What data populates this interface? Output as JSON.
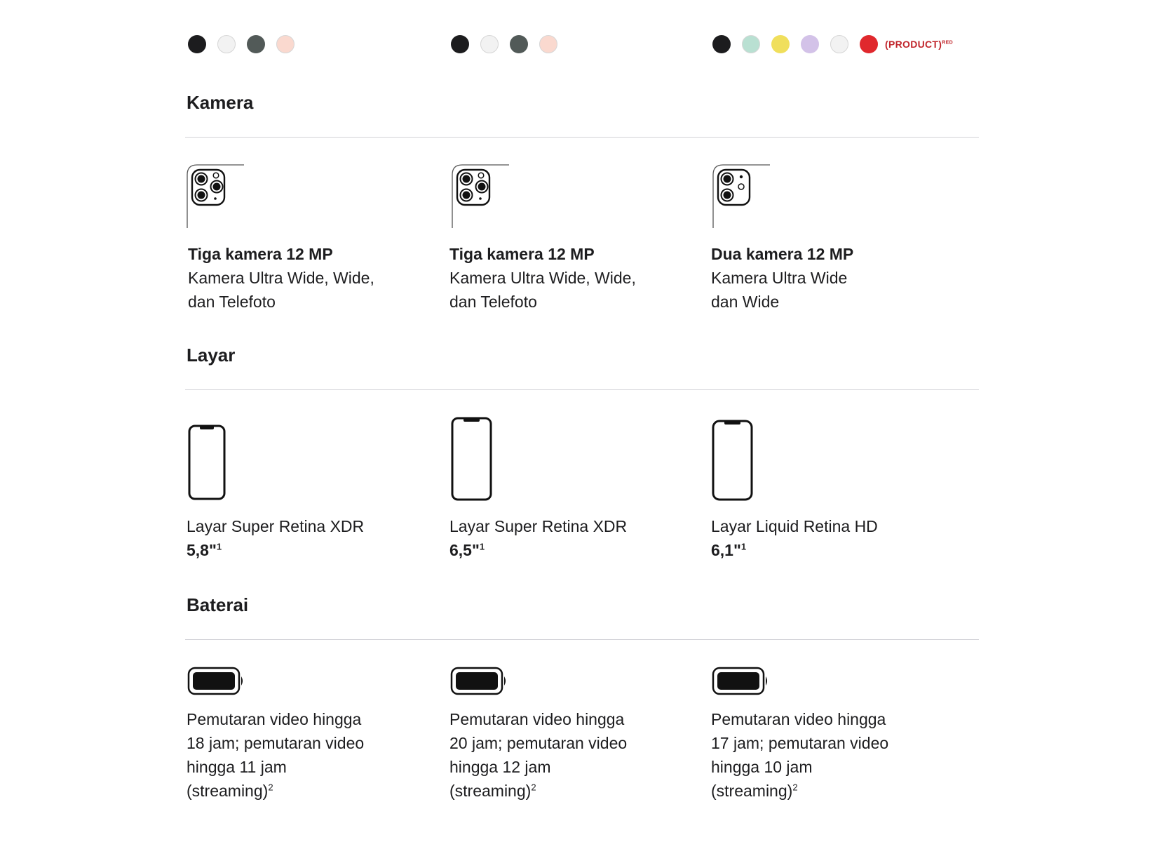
{
  "colors": {
    "col1": [
      "#1c1c1e",
      "#f2f2f2",
      "#525a58",
      "#fad9cf"
    ],
    "col2": [
      "#1c1c1e",
      "#f2f2f2",
      "#525a58",
      "#fad9cf"
    ],
    "col3": [
      "#1c1c1e",
      "#b9e0d2",
      "#f0df5c",
      "#d3c2e8",
      "#f2f2f2",
      "#e0282d"
    ],
    "product_red_label": "(PRODUCT)",
    "product_red_sup": "RED"
  },
  "sections": {
    "camera": "Kamera",
    "display": "Layar",
    "battery": "Baterai"
  },
  "camera": [
    {
      "title": "Tiga kamera 12 MP",
      "line1": "Kamera Ultra Wide, Wide,",
      "line2": "dan Telefoto"
    },
    {
      "title": "Tiga kamera 12 MP",
      "line1": "Kamera Ultra Wide, Wide,",
      "line2": "dan Telefoto"
    },
    {
      "title": "Dua kamera 12 MP",
      "line1": "Kamera Ultra Wide",
      "line2": "dan Wide"
    }
  ],
  "display": [
    {
      "name": "Layar Super Retina XDR",
      "size": "5,8\"",
      "note": "1"
    },
    {
      "name": "Layar Super Retina XDR",
      "size": "6,5\"",
      "note": "1"
    },
    {
      "name": "Layar Liquid Retina HD",
      "size": "6,1\"",
      "note": "1"
    }
  ],
  "battery": [
    {
      "line1": "Pemutaran video hingga",
      "line2": "18 jam; pemutaran video",
      "line3": "hingga 11 jam",
      "line4": "(streaming)",
      "note": "2"
    },
    {
      "line1": "Pemutaran video hingga",
      "line2": "20 jam; pemutaran video",
      "line3": "hingga 12 jam",
      "line4": "(streaming)",
      "note": "2"
    },
    {
      "line1": "Pemutaran video hingga",
      "line2": "17 jam; pemutaran video",
      "line3": "hingga 10 jam",
      "line4": "(streaming)",
      "note": "2"
    }
  ]
}
